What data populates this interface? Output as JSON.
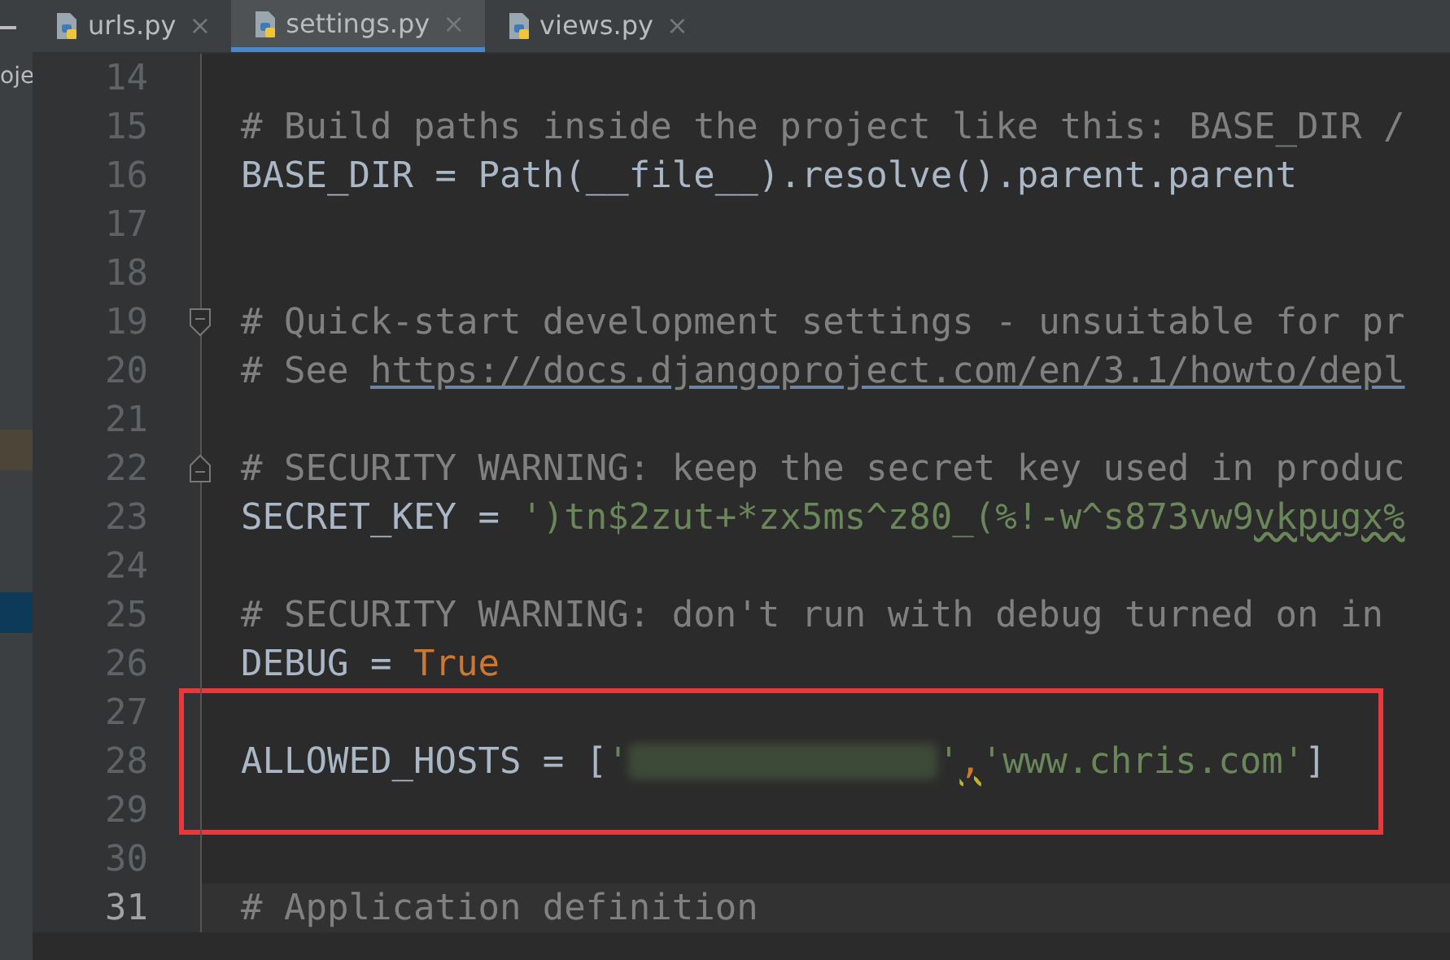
{
  "project_panel": {
    "label": "oje"
  },
  "tabs": [
    {
      "label": "urls.py",
      "close": "×",
      "selected": false
    },
    {
      "label": "settings.py",
      "close": "×",
      "selected": true
    },
    {
      "label": "views.py",
      "close": "×",
      "selected": false
    }
  ],
  "lines": [
    {
      "number": "14"
    },
    {
      "number": "15",
      "segments": [
        {
          "kind": "comment",
          "text": "# Build paths inside the project like this: BASE_DIR /"
        }
      ]
    },
    {
      "number": "16",
      "segments": [
        {
          "kind": "plain",
          "text": "BASE_DIR = Path(__file__).resolve().parent.parent"
        }
      ]
    },
    {
      "number": "17"
    },
    {
      "number": "18"
    },
    {
      "number": "19",
      "fold_start": true,
      "segments": [
        {
          "kind": "comment",
          "text": "# Quick-start development settings - unsuitable for pr"
        }
      ]
    },
    {
      "number": "20",
      "segments": [
        {
          "kind": "comment",
          "text": "# See "
        },
        {
          "kind": "link",
          "text": "https://docs.djangoproject.com/en/3.1/howto/depl"
        }
      ]
    },
    {
      "number": "21"
    },
    {
      "number": "22",
      "fold_end": true,
      "segments": [
        {
          "kind": "comment",
          "text": "# SECURITY WARNING: keep the secret key used in produc"
        }
      ]
    },
    {
      "number": "23",
      "segments": [
        {
          "kind": "plain",
          "text": "SECRET_KEY = "
        },
        {
          "kind": "string",
          "text": "')tn$2zut+*zx5ms^z80_(%!-w^s873vw9"
        },
        {
          "kind": "string_warning",
          "text": "vkpugx%"
        }
      ]
    },
    {
      "number": "24"
    },
    {
      "number": "25",
      "segments": [
        {
          "kind": "comment",
          "text": "# SECURITY WARNING: don't run with debug turned on in"
        }
      ]
    },
    {
      "number": "26",
      "segments": [
        {
          "kind": "plain",
          "text": "DEBUG = "
        },
        {
          "kind": "keyword",
          "text": "True"
        }
      ]
    },
    {
      "number": "27",
      "boxed": true
    },
    {
      "number": "28",
      "boxed": true,
      "segments": [
        {
          "kind": "plain",
          "text": "ALLOWED_HOSTS = ["
        },
        {
          "kind": "string",
          "text": "'"
        },
        {
          "kind": "redacted"
        },
        {
          "kind": "string",
          "text": "'"
        },
        {
          "kind": "comma_warning",
          "text": ","
        },
        {
          "kind": "string",
          "text": "'www.chris.com'"
        },
        {
          "kind": "plain",
          "text": "]"
        }
      ]
    },
    {
      "number": "29",
      "boxed": true
    },
    {
      "number": "30"
    },
    {
      "number": "31",
      "current": true,
      "segments": [
        {
          "kind": "comment",
          "text": "# Application definition"
        }
      ]
    }
  ]
}
